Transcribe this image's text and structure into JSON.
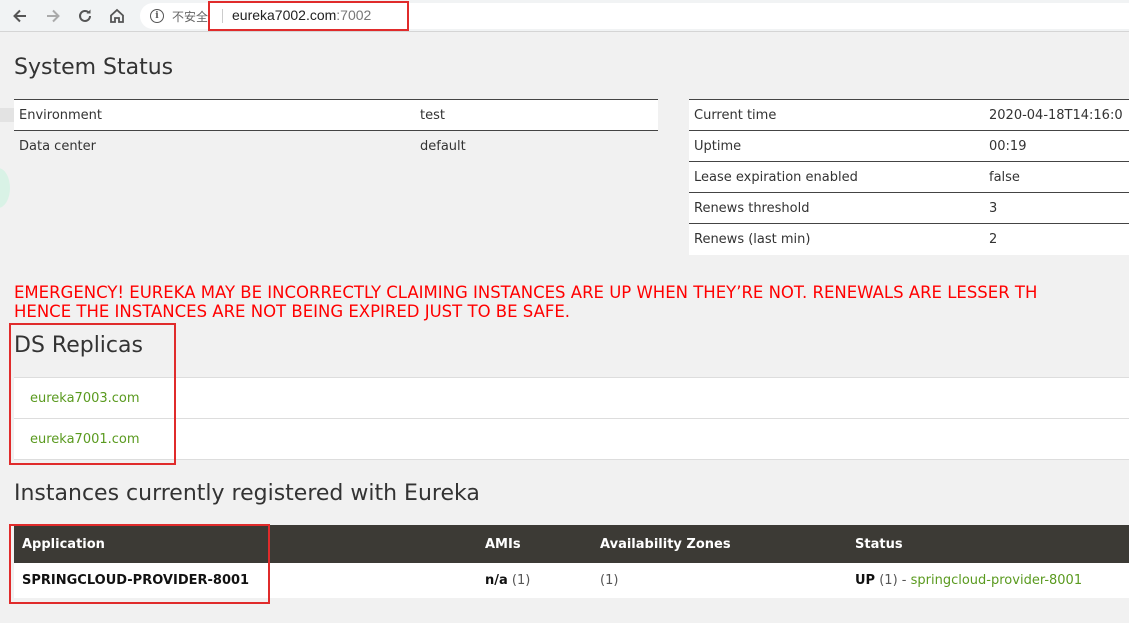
{
  "browser": {
    "insecure_label": "不安全",
    "url_host": "eureka7002.com",
    "url_port": ":7002"
  },
  "system_status": {
    "title": "System Status",
    "left": [
      {
        "key": "Environment",
        "value": "test"
      },
      {
        "key": "Data center",
        "value": "default"
      }
    ],
    "right": [
      {
        "key": "Current time",
        "value": "2020-04-18T14:16:0"
      },
      {
        "key": "Uptime",
        "value": "00:19"
      },
      {
        "key": "Lease expiration enabled",
        "value": "false"
      },
      {
        "key": "Renews threshold",
        "value": "3"
      },
      {
        "key": "Renews (last min)",
        "value": "2"
      }
    ]
  },
  "emergency": {
    "line1": "EMERGENCY! EUREKA MAY BE INCORRECTLY CLAIMING INSTANCES ARE UP WHEN THEY’RE NOT. RENEWALS ARE LESSER TH",
    "line2": "HENCE THE INSTANCES ARE NOT BEING EXPIRED JUST TO BE SAFE."
  },
  "replicas": {
    "title": "DS Replicas",
    "items": [
      "eureka7003.com",
      "eureka7001.com"
    ]
  },
  "instances": {
    "title": "Instances currently registered with Eureka",
    "headers": [
      "Application",
      "AMIs",
      "Availability Zones",
      "Status"
    ],
    "rows": [
      {
        "application": "SPRINGCLOUD-PROVIDER-8001",
        "amis": "n/a",
        "amis_count": "(1)",
        "zones": "(1)",
        "status": "UP",
        "status_count": "(1) -",
        "status_link": "springcloud-provider-8001"
      }
    ]
  },
  "colors": {
    "emergency": "#ff0000",
    "link": "#5a9a1f",
    "header_bg": "#3c3a35",
    "highlight_box": "#e02b2b"
  },
  "icons": [
    "back-arrow-icon",
    "forward-arrow-icon",
    "reload-icon",
    "home-icon",
    "info-icon"
  ]
}
